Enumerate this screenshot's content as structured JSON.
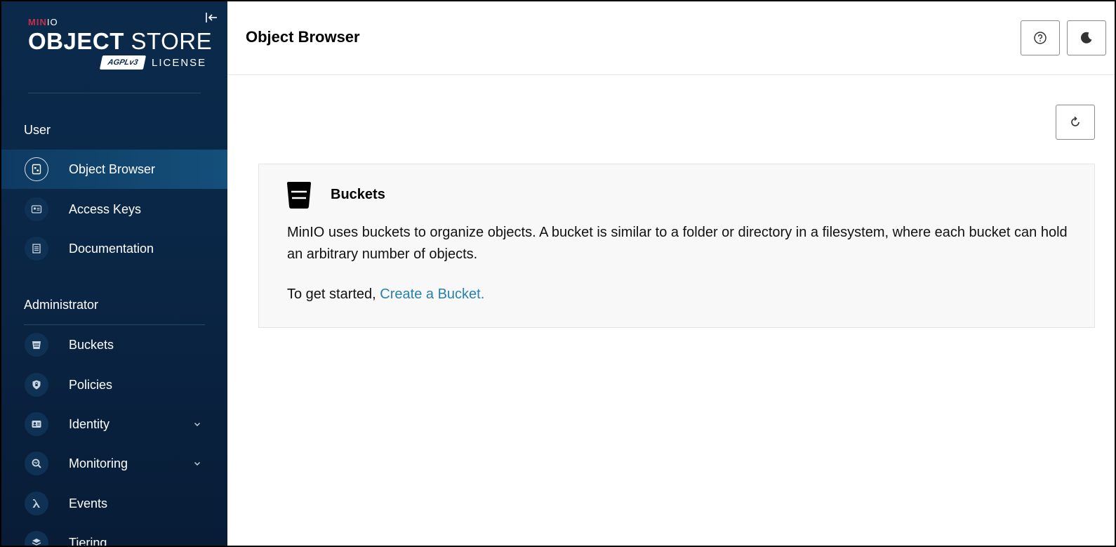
{
  "sidebar": {
    "logo": {
      "brand": "MINIO",
      "product_bold": "OBJECT",
      "product_light": "STORE",
      "badge": "AGPLv3",
      "license": "LICENSE"
    },
    "sections": {
      "user": "User",
      "administrator": "Administrator"
    },
    "user_items": [
      {
        "label": "Object Browser",
        "icon": "object-browser-icon"
      },
      {
        "label": "Access Keys",
        "icon": "access-keys-icon"
      },
      {
        "label": "Documentation",
        "icon": "documentation-icon"
      }
    ],
    "admin_items": [
      {
        "label": "Buckets",
        "icon": "bucket-icon"
      },
      {
        "label": "Policies",
        "icon": "policies-icon"
      },
      {
        "label": "Identity",
        "icon": "identity-icon"
      },
      {
        "label": "Monitoring",
        "icon": "monitoring-icon"
      },
      {
        "label": "Events",
        "icon": "lambda-icon"
      },
      {
        "label": "Tiering",
        "icon": "tiering-icon"
      }
    ]
  },
  "header": {
    "title": "Object Browser"
  },
  "main": {
    "info": {
      "title": "Buckets",
      "description": "MinIO uses buckets to organize objects. A bucket is similar to a folder or directory in a filesystem, where each bucket can hold an arbitrary number of objects.",
      "cta_prefix": "To get started, ",
      "cta_link": "Create a Bucket."
    }
  },
  "colors": {
    "sidebar_bg": "#0b2a4b",
    "active_item": "#14507a",
    "link": "#2781b0",
    "brand_red": "#c72e49"
  }
}
